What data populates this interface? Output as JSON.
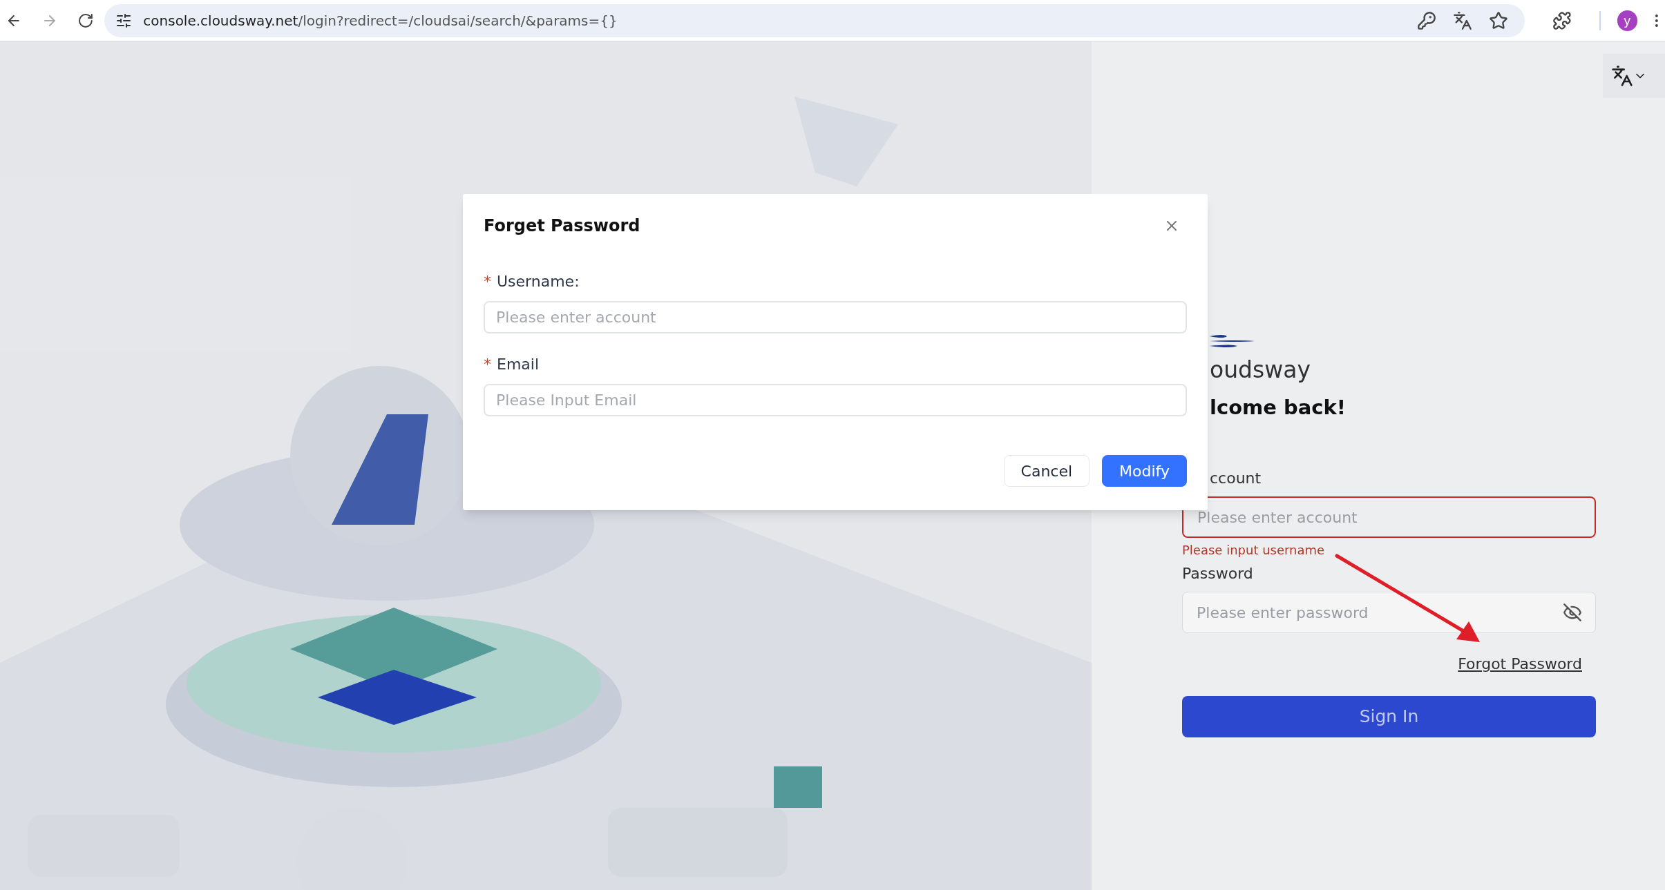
{
  "browser": {
    "url_host": "console.cloudsway.net",
    "url_path": "/login?redirect=/cloudsai/search/&params={}",
    "avatar_letter": "y"
  },
  "login": {
    "brand": "oudsway",
    "heading": "lcome back!",
    "account_label": "ccount",
    "account_placeholder": "Please enter account",
    "account_error": "Please input username",
    "password_label": "Password",
    "password_placeholder": "Please enter password",
    "forgot_link": "Forgot Password",
    "sign_in": "Sign In"
  },
  "dialog": {
    "title": "Forget Password",
    "fields": [
      {
        "label": "Username:",
        "required_mark": "*",
        "placeholder": "Please enter account"
      },
      {
        "label": "Email",
        "required_mark": "*",
        "placeholder": "Please Input Email"
      }
    ],
    "buttons": [
      {
        "label": "Cancel",
        "kind": "secondary"
      },
      {
        "label": "Modify",
        "kind": "primary"
      }
    ]
  }
}
